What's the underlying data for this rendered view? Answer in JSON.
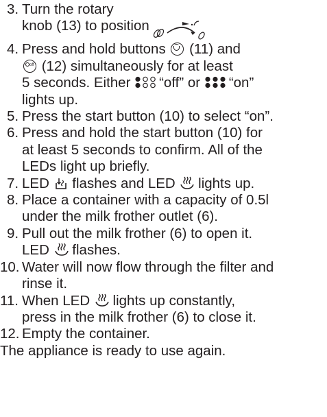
{
  "steps": [
    {
      "num": "3.",
      "lines": [
        "Turn the rotary",
        "knob (13) to position"
      ]
    },
    {
      "num": "4.",
      "lines": [
        "Press and hold buttons",
        "(11) and",
        "(12) simultaneously for at least",
        "5 seconds. Either",
        "“off” or",
        "“on”",
        "lights up."
      ]
    },
    {
      "num": "5.",
      "lines": [
        "Press the start button (10) to select “on”."
      ]
    },
    {
      "num": "6.",
      "lines": [
        "Press and hold the start button (10) for",
        "at least 5 seconds to confirm. All of the",
        "LEDs light up briefly."
      ]
    },
    {
      "num": "7.",
      "lines": [
        "LED",
        "flashes and LED",
        "lights up."
      ]
    },
    {
      "num": "8.",
      "lines": [
        "Place a container with a capacity of 0.5l",
        "under the milk frother outlet (6)."
      ]
    },
    {
      "num": "9.",
      "lines": [
        "Pull out the milk frother (6) to open it.",
        "LED",
        "flashes."
      ]
    },
    {
      "num": "10.",
      "lines": [
        "Water will now flow through the filter and",
        "rinse it."
      ]
    },
    {
      "num": "11.",
      "lines": [
        "When LED",
        "lights up constantly,",
        "press in the milk frother (6) to close it."
      ]
    },
    {
      "num": "12.",
      "lines": [
        "Empty the container."
      ]
    }
  ],
  "closing": "The appliance is ready to use again.",
  "icons": {
    "rotary_position": "rotary-position-icon",
    "button_11": "coffee-cup-button-icon",
    "button_12": "off-button-icon",
    "led_off": "led-off-pattern-icon",
    "led_on": "led-on-pattern-icon",
    "filter_led": "filter-led-icon",
    "steam_led": "steam-led-icon"
  }
}
